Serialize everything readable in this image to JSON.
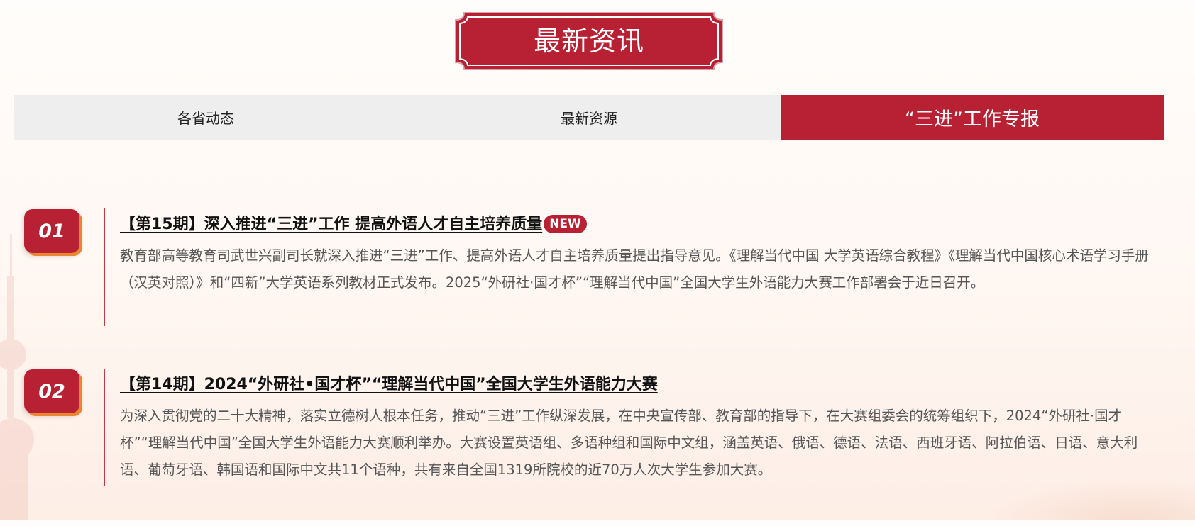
{
  "header": {
    "title": "最新资讯"
  },
  "tabs": [
    {
      "label": "各省动态",
      "active": false
    },
    {
      "label": "最新资源",
      "active": false
    },
    {
      "label": "“三进”工作专报",
      "active": true
    }
  ],
  "news": [
    {
      "number": "01",
      "title": "【第15期】深入推进“三进”工作 提高外语人才自主培养质量",
      "badge": "NEW",
      "summary": "教育部高等教育司武世兴副司长就深入推进“三进”工作、提高外语人才自主培养质量提出指导意见。《理解当代中国 大学英语综合教程》《理解当代中国核心术语学习手册（汉英对照）》和“四新”大学英语系列教材正式发布。2025“外研社·国才杯”“理解当代中国”全国大学生外语能力大赛工作部署会于近日召开。"
    },
    {
      "number": "02",
      "title": "【第14期】2024“外研社•国才杯”“理解当代中国”全国大学生外语能力大赛",
      "summary": "为深入贯彻党的二十大精神，落实立德树人根本任务，推动“三进”工作纵深发展，在中央宣传部、教育部的指导下，在大赛组委会的统筹组织下，2024“外研社·国才杯”“理解当代中国”全国大学生外语能力大赛顺利举办。大赛设置英语组、多语种组和国际中文组，涵盖英语、俄语、德语、法语、西班牙语、阿拉伯语、日语、意大利语、葡萄牙语、韩国语和国际中文共11个语种，共有来自全国1319所院校的近70万人次大学生参加大赛。"
    }
  ],
  "colors": {
    "brand_red": "#b82134",
    "accent_orange": "#e9862f",
    "tab_bg": "#eeeeee"
  }
}
